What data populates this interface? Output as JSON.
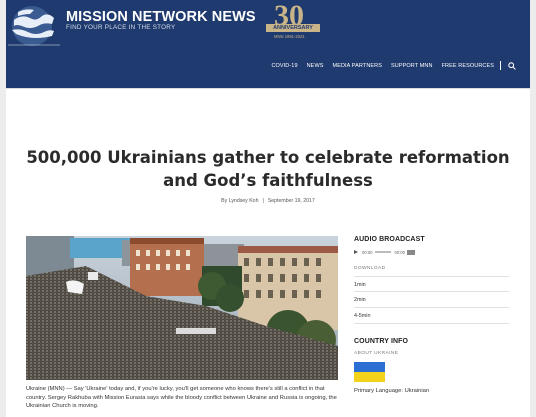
{
  "brand": {
    "name": "MISSION NETWORK NEWS",
    "tagline": "FIND YOUR PLACE IN THE STORY"
  },
  "anniversary": {
    "number": "30",
    "label": "ANNIVERSARY",
    "years": "MNN 1991-2021"
  },
  "nav": {
    "items": [
      "COVID-19",
      "NEWS",
      "MEDIA PARTNERS",
      "SUPPORT MNN",
      "FREE RESOURCES"
    ]
  },
  "article": {
    "title": "500,000 Ukrainians gather to celebrate reformation and God’s faithfulness",
    "author": "By Lyndsey Koh",
    "date": "September 19, 2017",
    "lead": "Ukraine (MNN) — Say 'Ukraine' today and, if you're lucky, you'll get someone who knows there's still a conflict in that country. Sergey Rakhuba with Mission Eurasia says while the bloody conflict between Ukraine and Russia is ongoing, the Ukrainian Church is moving."
  },
  "sidebar": {
    "audio_heading": "AUDIO BROADCAST",
    "player": {
      "current": "00:00",
      "duration": "00:00"
    },
    "download_label": "DOWNLOAD",
    "downloads": [
      "1min",
      "2min",
      "4-5min"
    ],
    "country_heading": "COUNTRY INFO",
    "about_label": "ABOUT UKRAINE",
    "language": "Primary Language: Ukrainian"
  },
  "colors": {
    "header_bg": "#1f3a6e",
    "accent_gold": "#c9b489",
    "flag_blue": "#2a6fd1",
    "flag_yellow": "#f2d21a"
  },
  "icons": {
    "logo": "globe-logo-icon",
    "search": "search-icon",
    "play": "play-icon",
    "volume": "volume-icon"
  }
}
